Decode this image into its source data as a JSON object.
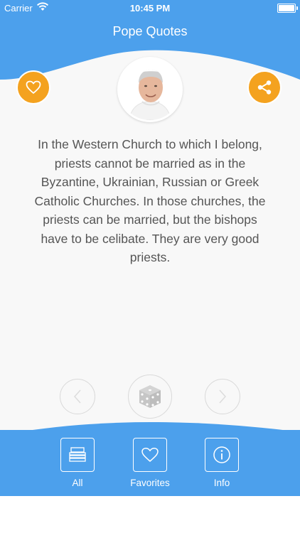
{
  "status_bar": {
    "carrier": "Carrier",
    "time": "10:45 PM"
  },
  "nav": {
    "title": "Pope Quotes"
  },
  "quote": {
    "text": "In the Western Church to which I belong, priests cannot be married as in the Byzantine, Ukrainian, Russian or Greek Catholic Churches. In those churches, the priests can be married, but the bishops have to be celibate. They are very good priests."
  },
  "tabs": [
    {
      "label": "All",
      "icon": "stack-icon"
    },
    {
      "label": "Favorites",
      "icon": "heart-icon"
    },
    {
      "label": "Info",
      "icon": "info-icon"
    }
  ],
  "colors": {
    "primary_blue": "#4ca0ec",
    "accent_orange": "#f4a21f",
    "background": "#f8f8f8"
  }
}
